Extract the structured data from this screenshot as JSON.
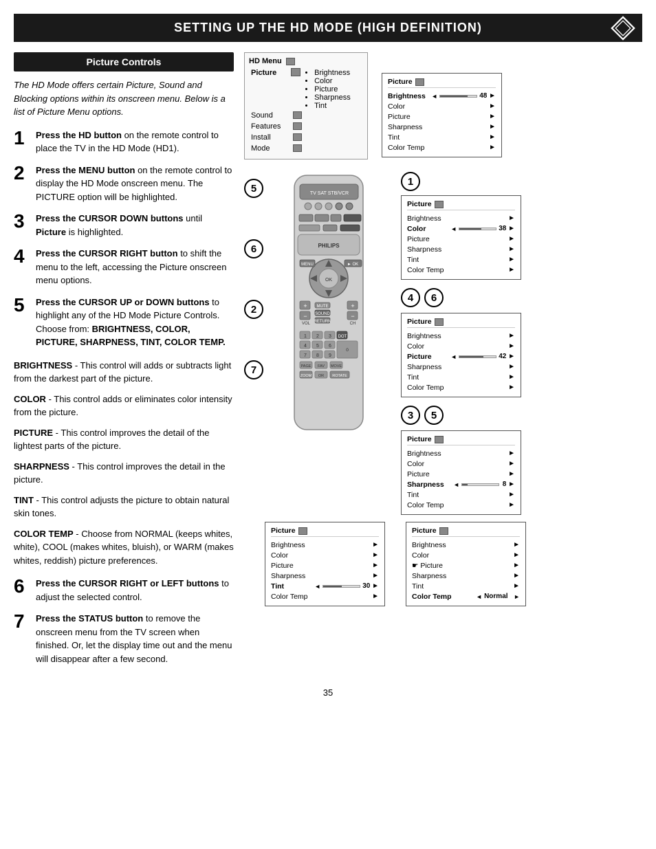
{
  "header": {
    "title": "Setting up the HD Mode (High Definition)"
  },
  "section": {
    "title": "Picture Controls"
  },
  "intro": "The HD Mode offers certain Picture, Sound and Blocking options within its onscreen menu. Below is a list of Picture Menu options.",
  "steps": [
    {
      "number": "1",
      "text": "Press the HD button on the remote control to place the TV in the HD Mode (HD1)."
    },
    {
      "number": "2",
      "text": "Press the MENU button on the remote control to display the HD Mode onscreen menu. The PICTURE option will be highlighted."
    },
    {
      "number": "3",
      "text": "Press the CURSOR DOWN buttons until Picture is highlighted."
    },
    {
      "number": "4",
      "text": "Press the CURSOR RIGHT button to shift the menu to the left, accessing the Picture onscreen menu options."
    },
    {
      "number": "5",
      "text": "Press the CURSOR UP or DOWN buttons to highlight any of the HD Mode Picture Controls. Choose from: BRIGHTNESS, COLOR, PICTURE, SHARPNESS, TINT, COLOR TEMP."
    }
  ],
  "descriptions": [
    {
      "term": "BRIGHTNESS",
      "text": "- This control will adds or subtracts light from the darkest part of the picture."
    },
    {
      "term": "COLOR",
      "text": "- This control adds or eliminates color intensity from the picture."
    },
    {
      "term": "PICTURE",
      "text": "- This control improves the detail of the lightest parts of the picture."
    },
    {
      "term": "SHARPNESS",
      "text": "- This control improves the detail in the picture."
    },
    {
      "term": "TINT",
      "text": "- This control adjusts the picture to obtain natural skin tones."
    },
    {
      "term": "COLOR TEMP",
      "text": "- Choose from NORMAL (keeps whites, white), COOL (makes whites, bluish), or WARM (makes whites, reddish) picture preferences."
    }
  ],
  "steps_bottom": [
    {
      "number": "6",
      "text": "Press the CURSOR RIGHT or LEFT buttons to adjust the selected control."
    },
    {
      "number": "7",
      "text": "Press the STATUS button to remove the onscreen menu from the TV screen when finished. Or, let the display time out and the menu will disappear after a few second."
    }
  ],
  "hd_menu": {
    "title": "HD Menu",
    "rows": [
      {
        "label": "Picture",
        "active": true
      },
      {
        "label": "Sound",
        "active": false
      },
      {
        "label": "Features",
        "active": false
      },
      {
        "label": "Install",
        "active": false
      },
      {
        "label": "Mode",
        "active": false
      }
    ],
    "items": [
      "Brightness",
      "Color",
      "Picture",
      "Sharpness",
      "Tint"
    ]
  },
  "panels": [
    {
      "title": "Picture",
      "rows": [
        {
          "label": "Brightness",
          "active": true,
          "value": "48",
          "hasSlider": true
        },
        {
          "label": "Color",
          "active": false,
          "value": null
        },
        {
          "label": "Picture",
          "active": false,
          "value": null
        },
        {
          "label": "Sharpness",
          "active": false,
          "value": null
        },
        {
          "label": "Tint",
          "active": false,
          "value": null
        },
        {
          "label": "Color Temp",
          "active": false,
          "value": null
        }
      ]
    },
    {
      "title": "Picture",
      "rows": [
        {
          "label": "Brightness",
          "active": false,
          "value": null
        },
        {
          "label": "Color",
          "active": true,
          "value": "38",
          "hasSlider": true
        },
        {
          "label": "Picture",
          "active": false,
          "value": null
        },
        {
          "label": "Sharpness",
          "active": false,
          "value": null
        },
        {
          "label": "Tint",
          "active": false,
          "value": null
        },
        {
          "label": "Color Temp",
          "active": false,
          "value": null
        }
      ]
    },
    {
      "title": "Picture",
      "rows": [
        {
          "label": "Brightness",
          "active": false,
          "value": null
        },
        {
          "label": "Color",
          "active": false,
          "value": null
        },
        {
          "label": "Picture",
          "active": true,
          "value": "42",
          "hasSlider": true
        },
        {
          "label": "Sharpness",
          "active": false,
          "value": null
        },
        {
          "label": "Tint",
          "active": false,
          "value": null
        },
        {
          "label": "Color Temp",
          "active": false,
          "value": null
        }
      ]
    },
    {
      "title": "Picture",
      "rows": [
        {
          "label": "Brightness",
          "active": false,
          "value": null
        },
        {
          "label": "Color",
          "active": false,
          "value": null
        },
        {
          "label": "Picture",
          "active": false,
          "value": null
        },
        {
          "label": "Sharpness",
          "active": true,
          "value": "8",
          "hasSlider": true
        },
        {
          "label": "Tint",
          "active": false,
          "value": null
        },
        {
          "label": "Color Temp",
          "active": false,
          "value": null
        }
      ]
    },
    {
      "title": "Picture",
      "rows": [
        {
          "label": "Brightness",
          "active": false,
          "value": null
        },
        {
          "label": "Color",
          "active": false,
          "value": null
        },
        {
          "label": "Picture",
          "active": false,
          "value": null
        },
        {
          "label": "Sharpness",
          "active": false,
          "value": null
        },
        {
          "label": "Tint",
          "active": true,
          "value": "30",
          "hasSlider": true
        },
        {
          "label": "Color Temp",
          "active": false,
          "value": null
        }
      ]
    },
    {
      "title": "Picture",
      "rows": [
        {
          "label": "Brightness",
          "active": false,
          "value": null
        },
        {
          "label": "Color",
          "active": false,
          "value": null
        },
        {
          "label": "Picture",
          "active": false,
          "value": null
        },
        {
          "label": "Sharpness",
          "active": false,
          "value": null
        },
        {
          "label": "Tint",
          "active": false,
          "value": null
        },
        {
          "label": "Color Temp",
          "active": true,
          "value": "Normal",
          "isText": true
        }
      ]
    }
  ],
  "page_number": "35"
}
